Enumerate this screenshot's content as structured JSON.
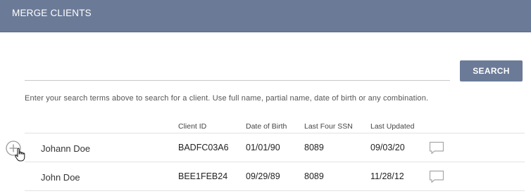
{
  "header": {
    "title": "MERGE CLIENTS"
  },
  "search": {
    "value": "",
    "placeholder": "",
    "button_label": "SEARCH",
    "hint": "Enter your search terms above to search for a client. Use full name, partial name, date of birth or any combination."
  },
  "table": {
    "columns": {
      "client_id": "Client ID",
      "dob": "Date of Birth",
      "ssn": "Last Four SSN",
      "updated": "Last Updated"
    },
    "rows": [
      {
        "name": "Johann Doe",
        "client_id": "BADFC03A6",
        "dob": "01/01/90",
        "ssn": "8089",
        "updated": "09/03/20"
      },
      {
        "name": "John Doe",
        "client_id": "BEE1FEB24",
        "dob": "09/29/89",
        "ssn": "8089",
        "updated": "11/28/12"
      }
    ]
  },
  "colors": {
    "header": "#6b7a97",
    "button": "#6b7a97"
  },
  "icons": {
    "row_add": "plus-circle-icon",
    "comment": "comment-icon",
    "pointer": "hand-cursor-icon"
  }
}
